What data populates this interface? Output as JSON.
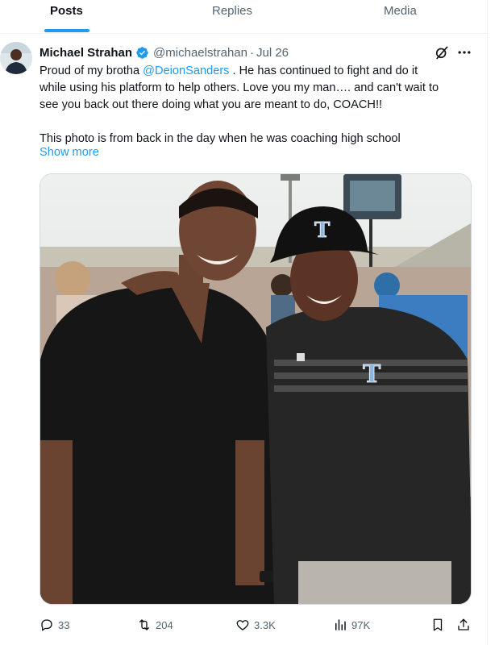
{
  "tabs": [
    {
      "label": "Posts",
      "active": true
    },
    {
      "label": "Replies",
      "active": false
    },
    {
      "label": "Media",
      "active": false
    }
  ],
  "tweet": {
    "author_name": "Michael Strahan",
    "handle": "@michaelstrahan",
    "separator": "·",
    "date": "Jul 26",
    "text_line1_pre": "Proud of my brotha ",
    "mention": "@DeionSanders",
    "text_line1_post": " . He has continued to fight and do it",
    "text_line2": "while using his platform to help others. Love you my man…. and can't wait to",
    "text_line3": "see you back out there doing what you are meant to do, COACH!!",
    "text_line4": "This photo is from back in the day when he was coaching high school",
    "show_more": "Show more"
  },
  "photo": {
    "cap_logo_letter": "T",
    "shirt_logo_letter": "T"
  },
  "actions": {
    "replies": "33",
    "reposts": "204",
    "likes": "3.3K",
    "views": "97K"
  },
  "colors": {
    "accent": "#1d9bf0",
    "text_secondary": "#536471",
    "border": "#cfd9de"
  },
  "icons": [
    "verified-icon",
    "grok-icon",
    "more-icon",
    "reply-icon",
    "repost-icon",
    "like-icon",
    "views-icon",
    "bookmark-icon",
    "share-icon"
  ]
}
